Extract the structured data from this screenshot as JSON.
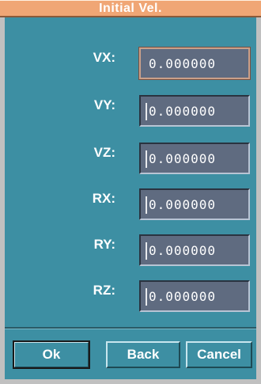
{
  "window": {
    "title": "Initial Vel."
  },
  "fields": [
    {
      "label": "VX:",
      "value": "0.000000"
    },
    {
      "label": "VY:",
      "value": "0.000000"
    },
    {
      "label": "VZ:",
      "value": "0.000000"
    },
    {
      "label": "RX:",
      "value": "0.000000"
    },
    {
      "label": "RY:",
      "value": "0.000000"
    },
    {
      "label": "RZ:",
      "value": "0.000000"
    }
  ],
  "buttons": {
    "ok": "Ok",
    "back": "Back",
    "cancel": "Cancel"
  },
  "colors": {
    "background": "#3d8fa3",
    "titlebar": "#f0a675",
    "field": "#5f6b80"
  }
}
